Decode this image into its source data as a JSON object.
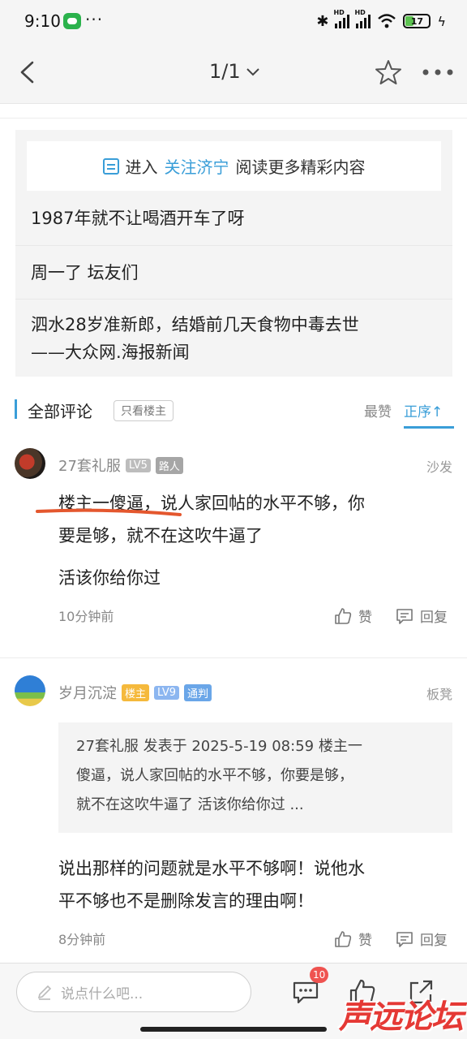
{
  "status": {
    "time": "9:10",
    "dots": "···",
    "battery": "17"
  },
  "nav": {
    "page_indicator": "1/1"
  },
  "related": {
    "banner_prefix": "进入",
    "banner_link": "关注济宁",
    "banner_suffix": "阅读更多精彩内容",
    "items": [
      "1987年就不让喝酒开车了呀",
      "周一了 坛友们",
      "泗水28岁准新郎，结婚前几天食物中毒去世",
      "——大众网.海报新闻"
    ]
  },
  "comments_header": {
    "title": "全部评论",
    "op_only": "只看楼主",
    "sort_hot": "最赞",
    "sort_order": "正序↑"
  },
  "comments": [
    {
      "user": "27套礼服",
      "badges": [
        "LV5",
        "路人"
      ],
      "floor": "沙发",
      "lines": [
        "楼主一傻逼，说人家回帖的水平不够，你",
        "要是够，就不在这吹牛逼了"
      ],
      "extra": "活该你给你过",
      "time": "10分钟前",
      "like": "赞",
      "reply": "回复"
    },
    {
      "user": "岁月沉淀",
      "badges": [
        "楼主",
        "LV9",
        "通判"
      ],
      "floor": "板凳",
      "quote": [
        "27套礼服 发表于 2025-5-19 08:59 楼主一",
        "傻逼，说人家回帖的水平不够，你要是够，",
        "就不在这吹牛逼了 活该你给你过 ..."
      ],
      "lines": [
        "说出那样的问题就是水平不够啊！说他水",
        "平不够也不是删除发言的理由啊！"
      ],
      "time": "8分钟前",
      "like": "赞",
      "reply": "回复"
    }
  ],
  "bottom": {
    "placeholder": "说点什么吧...",
    "comment_count": "10",
    "watermark": "声远论坛"
  },
  "colors": {
    "accent": "#3a9ed8",
    "badge_red": "#ef5350",
    "underline": "#e4572e"
  }
}
